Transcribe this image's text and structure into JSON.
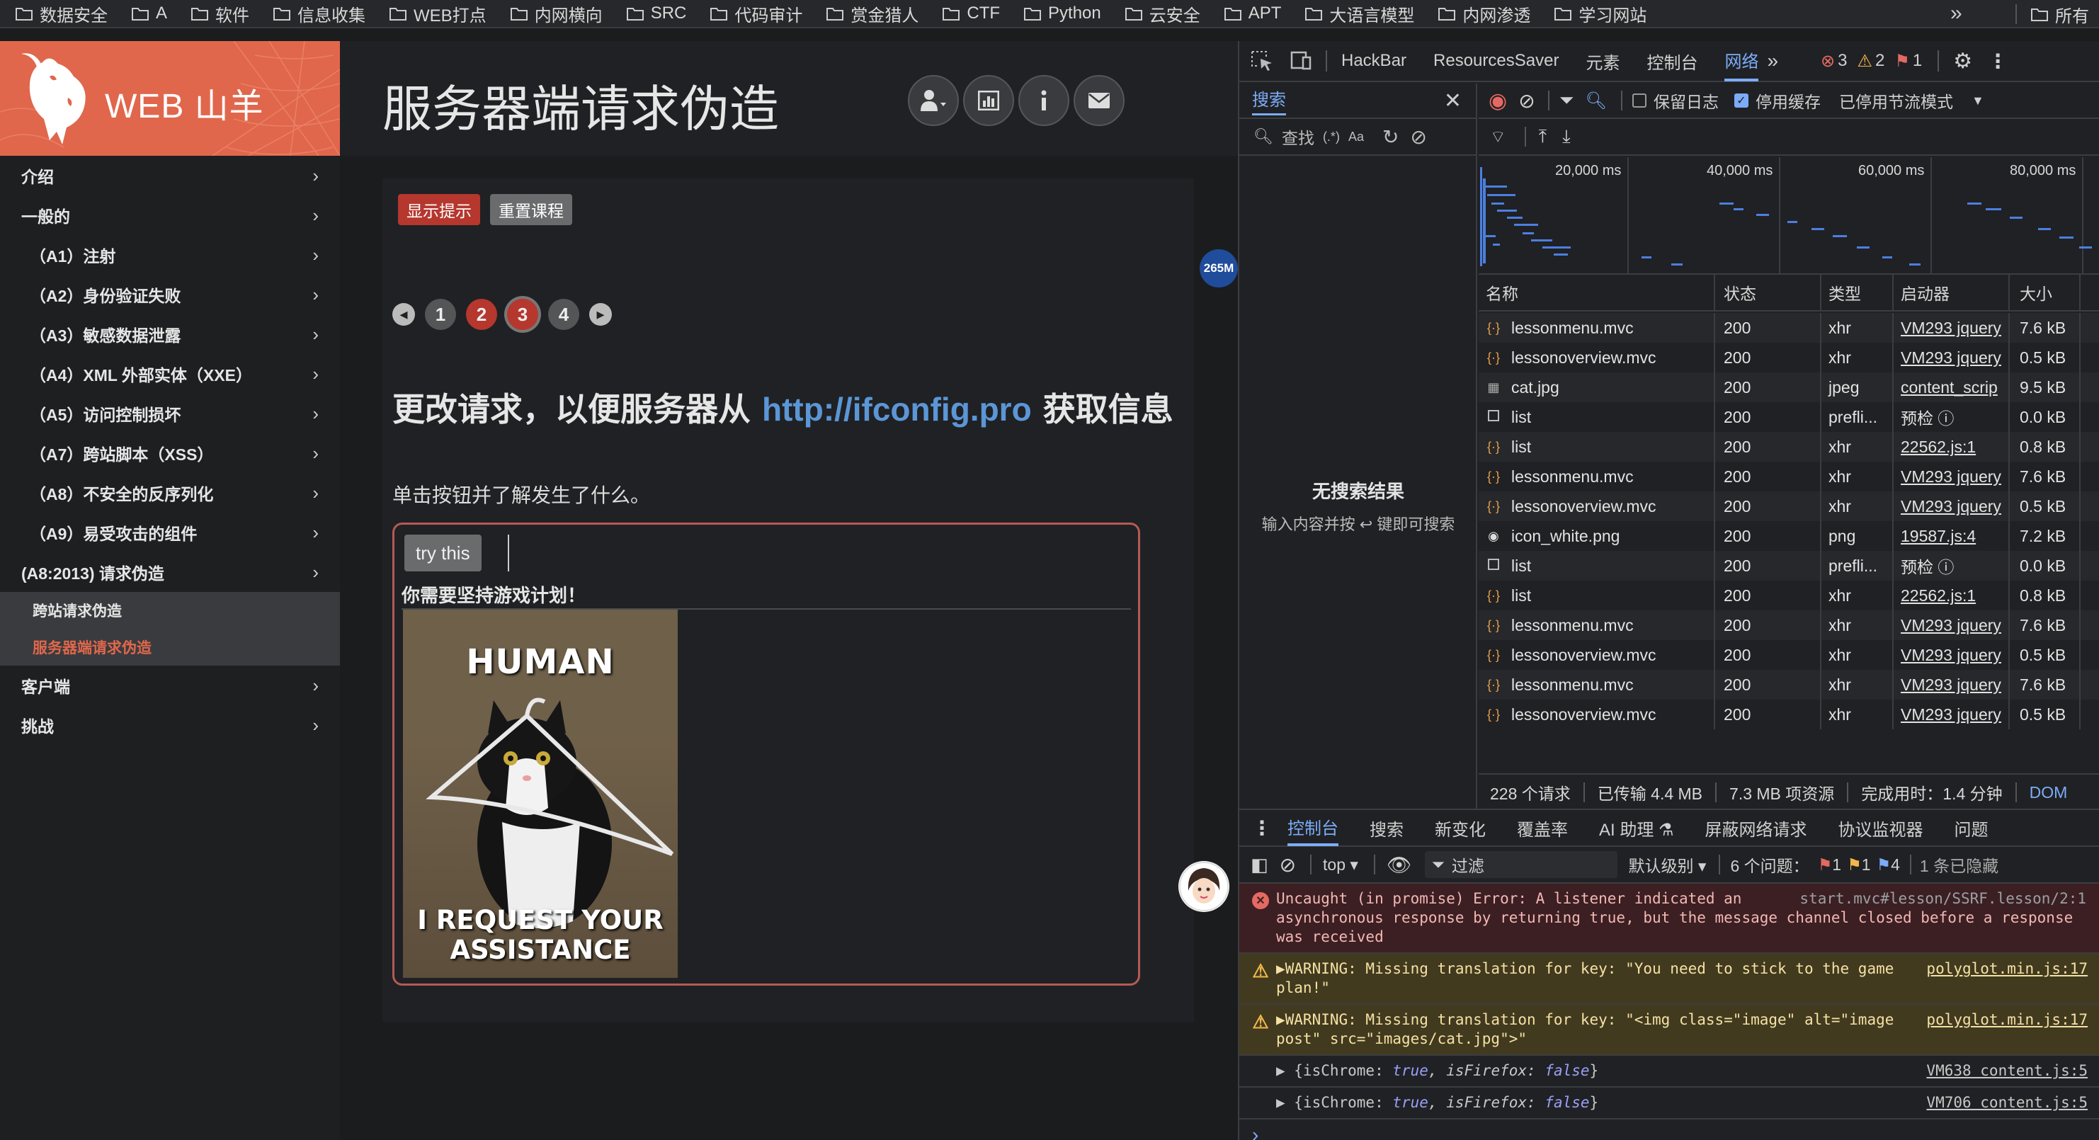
{
  "bookmarks": {
    "items": [
      "数据安全",
      "A",
      "软件",
      "信息收集",
      "WEB打点",
      "内网横向",
      "SRC",
      "代码审计",
      "赏金猎人",
      "CTF",
      "Python",
      "云安全",
      "APT",
      "大语言模型",
      "内网渗透",
      "学习网站"
    ],
    "more": "»",
    "all": "所有"
  },
  "logo": {
    "text": "WEB 山羊"
  },
  "nav": {
    "items": [
      {
        "label": "介绍"
      },
      {
        "label": "一般的"
      },
      {
        "label": "（A1）注射"
      },
      {
        "label": "（A2）身份验证失败"
      },
      {
        "label": "（A3）敏感数据泄露"
      },
      {
        "label": "（A4）XML 外部实体（XXE）"
      },
      {
        "label": "（A5）访问控制损坏"
      },
      {
        "label": "（A7）跨站脚本（XSS）"
      },
      {
        "label": "（A8）不安全的反序列化"
      },
      {
        "label": "（A9）易受攻击的组件"
      },
      {
        "label": "(A8:2013) 请求伪造"
      }
    ],
    "children": [
      "跨站请求伪造",
      "服务器端请求伪造"
    ],
    "bottom": [
      {
        "label": "客户端"
      },
      {
        "label": "挑战"
      }
    ],
    "chevron": "›"
  },
  "page": {
    "title": "服务器端请求伪造",
    "show_hint": "显示提示",
    "reset": "重置课程",
    "pages": [
      "1",
      "2",
      "3",
      "4"
    ],
    "current_page": 3,
    "headline_pre": "更改请求，以便服务器从 ",
    "headline_url": "http://ifconfig.pro",
    "headline_post": " 获取信息",
    "description": "单击按钮并了解发生了什么。",
    "try_button": "try this",
    "stick_msg": "你需要坚持游戏计划！",
    "meme_top": "HUMAN",
    "meme_bottom_1": "I REQUEST YOUR",
    "meme_bottom_2": "ASSISTANCE"
  },
  "memory_badge": "265M",
  "devtools": {
    "tabs": [
      "HackBar",
      "ResourcesSaver",
      "元素",
      "控制台",
      "网络"
    ],
    "active_tab": "网络",
    "more": "»",
    "counts": {
      "errors": "3",
      "warnings": "2",
      "issues": "1"
    },
    "search": {
      "tab": "搜索",
      "find_placeholder": "查找",
      "regex": "(.*)",
      "case": "Aa",
      "no_result": "无搜索结果",
      "hint": "输入内容并按 ↩ 键即可搜索"
    },
    "network": {
      "preserve_log": "保留日志",
      "disable_cache": "停用缓存",
      "throttle": "已停用节流模式",
      "overview_ticks": [
        "20,000 ms",
        "40,000 ms",
        "60,000 ms",
        "80,000 ms"
      ],
      "columns": [
        "名称",
        "状态",
        "类型",
        "启动器",
        "大小"
      ],
      "rows": [
        {
          "name": "lessonmenu.mvc",
          "status": "200",
          "type": "xhr",
          "initiator": "VM293 jquery",
          "size": "7.6 kB",
          "icon": "xhr"
        },
        {
          "name": "lessonoverview.mvc",
          "status": "200",
          "type": "xhr",
          "initiator": "VM293 jquery",
          "size": "0.5 kB",
          "icon": "xhr"
        },
        {
          "name": "cat.jpg",
          "status": "200",
          "type": "jpeg",
          "initiator": "content_scrip",
          "size": "9.5 kB",
          "icon": "img"
        },
        {
          "name": "list",
          "status": "200",
          "type": "prefli...",
          "initiator": "预检 ⓘ",
          "size": "0.0 kB",
          "icon": "box"
        },
        {
          "name": "list",
          "status": "200",
          "type": "xhr",
          "initiator": "22562.js:1",
          "size": "0.8 kB",
          "icon": "xhr"
        },
        {
          "name": "lessonmenu.mvc",
          "status": "200",
          "type": "xhr",
          "initiator": "VM293 jquery",
          "size": "7.6 kB",
          "icon": "xhr"
        },
        {
          "name": "lessonoverview.mvc",
          "status": "200",
          "type": "xhr",
          "initiator": "VM293 jquery",
          "size": "0.5 kB",
          "icon": "xhr"
        },
        {
          "name": "icon_white.png",
          "status": "200",
          "type": "png",
          "initiator": "19587.js:4",
          "size": "7.2 kB",
          "icon": "png"
        },
        {
          "name": "list",
          "status": "200",
          "type": "prefli...",
          "initiator": "预检 ⓘ",
          "size": "0.0 kB",
          "icon": "box"
        },
        {
          "name": "list",
          "status": "200",
          "type": "xhr",
          "initiator": "22562.js:1",
          "size": "0.8 kB",
          "icon": "xhr"
        },
        {
          "name": "lessonmenu.mvc",
          "status": "200",
          "type": "xhr",
          "initiator": "VM293 jquery",
          "size": "7.6 kB",
          "icon": "xhr"
        },
        {
          "name": "lessonoverview.mvc",
          "status": "200",
          "type": "xhr",
          "initiator": "VM293 jquery",
          "size": "0.5 kB",
          "icon": "xhr"
        },
        {
          "name": "lessonmenu.mvc",
          "status": "200",
          "type": "xhr",
          "initiator": "VM293 jquery",
          "size": "7.6 kB",
          "icon": "xhr"
        },
        {
          "name": "lessonoverview.mvc",
          "status": "200",
          "type": "xhr",
          "initiator": "VM293 jquery",
          "size": "0.5 kB",
          "icon": "xhr"
        }
      ],
      "summary": [
        "228 个请求",
        "已传输 4.4 MB",
        "7.3 MB 项资源",
        "完成用时：1.4 分钟",
        "DOM"
      ]
    },
    "console": {
      "tabs": [
        "控制台",
        "搜索",
        "新变化",
        "覆盖率",
        "AI 助理 ⚗",
        "屏蔽网络请求",
        "协议监视器",
        "问题"
      ],
      "context": "top ▾",
      "filter": "过滤",
      "level": "默认级别 ▾",
      "issues_label": "6 个问题：",
      "issue_counts": [
        "1",
        "1",
        "4"
      ],
      "hidden": "1 条已隐藏",
      "messages": [
        {
          "kind": "err",
          "text": "Uncaught (in promise) Error: A listener indicated an asynchronous response by returning true, but the message channel closed before a response was received",
          "src": "start.mvc#lesson/SSRF.lesson/2:1"
        },
        {
          "kind": "warn",
          "text": "▶WARNING: Missing translation for key: \"You need to stick to the game plan!\"",
          "src": "polyglot.min.js:17"
        },
        {
          "kind": "warn",
          "text": "▶WARNING: Missing translation for key: \"<img class=\"image\" alt=\"image post\" src=\"images/cat.jpg\">\"",
          "src": "polyglot.min.js:17"
        },
        {
          "kind": "info",
          "pre": "▶ {isChrome: ",
          "v1": "true",
          "mid": ", isFirefox: ",
          "v2": "false",
          "post": "}",
          "src": "VM638 content.js:5"
        },
        {
          "kind": "info",
          "pre": "▶ {isChrome: ",
          "v1": "true",
          "mid": ", isFirefox: ",
          "v2": "false",
          "post": "}",
          "src": "VM706 content.js:5"
        }
      ],
      "prompt": "›"
    }
  }
}
